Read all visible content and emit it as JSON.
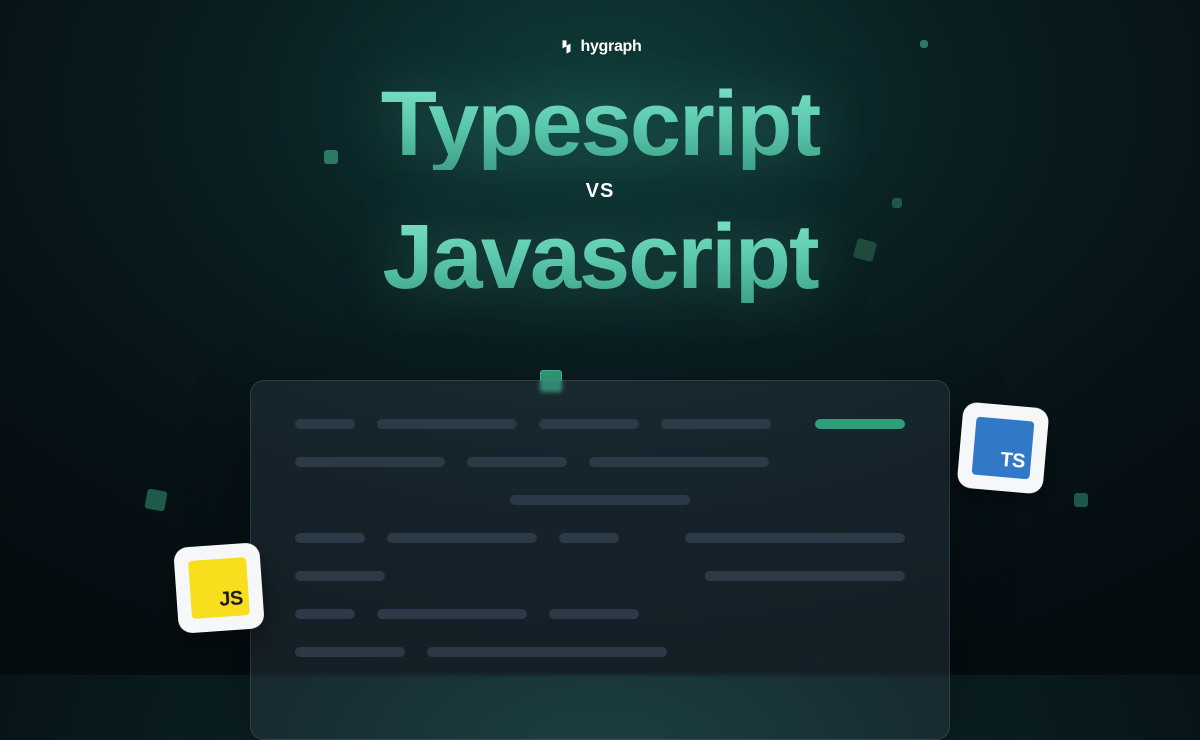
{
  "brand": {
    "name": "hygraph"
  },
  "title": {
    "line1": "Typescript",
    "vs": "VS",
    "line2": "Javascript"
  },
  "badges": {
    "js": "JS",
    "ts": "TS"
  },
  "colors": {
    "accent": "#5cc9ae",
    "js_bg": "#f7df1e",
    "ts_bg": "#3178c6",
    "bg_deep": "#050d11"
  }
}
